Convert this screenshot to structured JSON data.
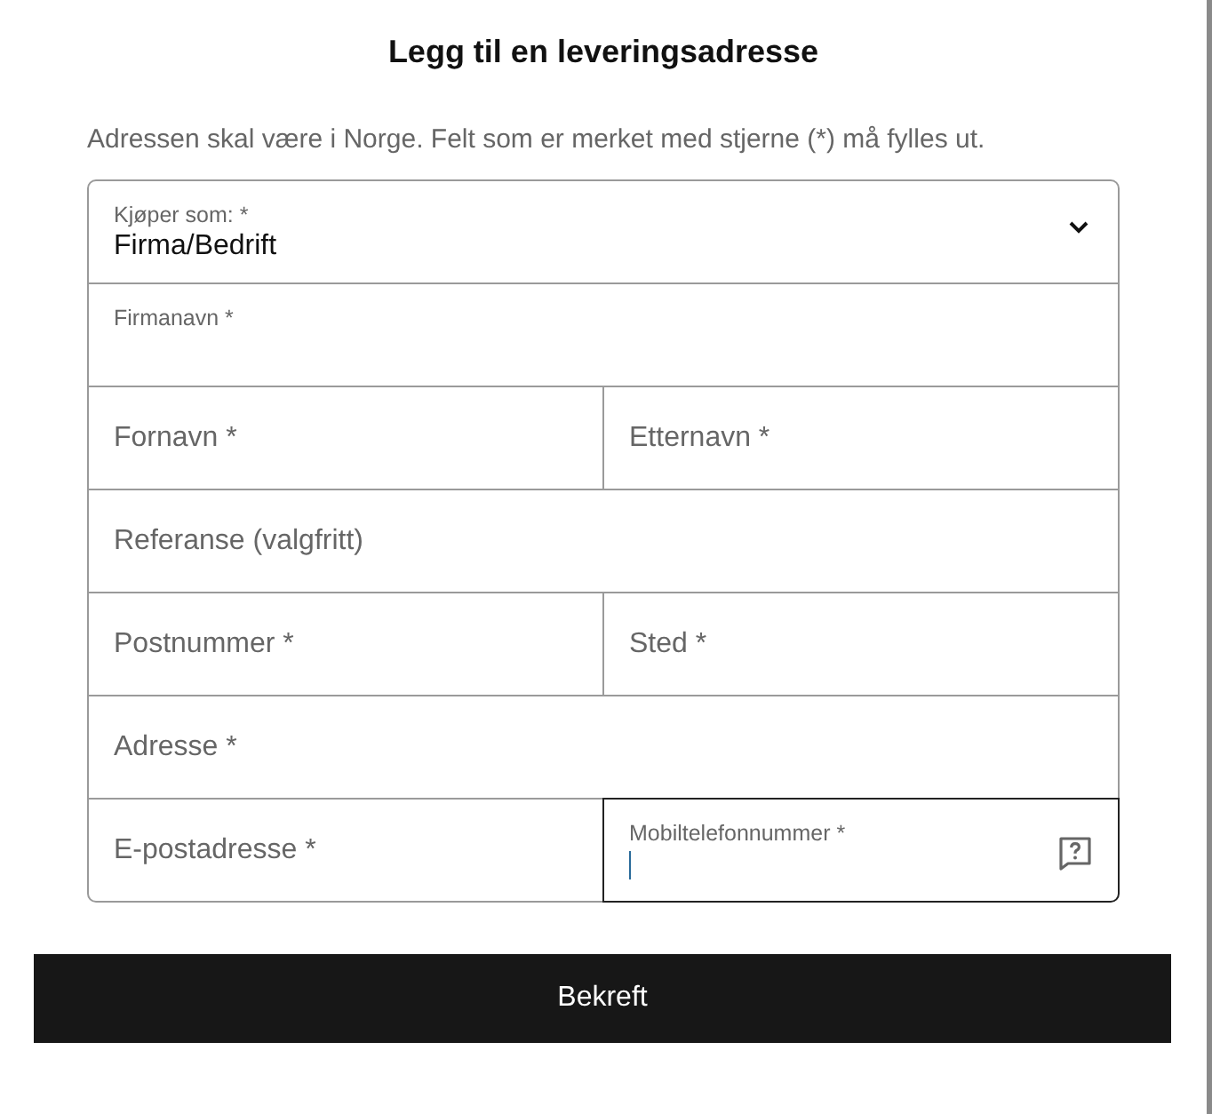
{
  "title": "Legg til en leveringsadresse",
  "intro": "Adressen skal være i Norge. Felt som er merket med stjerne (*) må fylles ut.",
  "rows": [
    [
      {
        "kind": "select",
        "label": "Kjøper som: *",
        "value": "Firma/Bedrift",
        "raised": true,
        "focused": false,
        "help": false
      }
    ],
    [
      {
        "kind": "text",
        "label": "Firmanavn *",
        "raised": true,
        "focused": false,
        "help": false
      }
    ],
    [
      {
        "kind": "text",
        "label": "Fornavn *",
        "raised": false,
        "focused": false,
        "help": false
      },
      {
        "kind": "text",
        "label": "Etternavn *",
        "raised": false,
        "focused": false,
        "help": false
      }
    ],
    [
      {
        "kind": "text",
        "label": "Referanse (valgfritt)",
        "raised": false,
        "focused": false,
        "help": false
      }
    ],
    [
      {
        "kind": "text",
        "label": "Postnummer *",
        "raised": false,
        "focused": false,
        "help": false
      },
      {
        "kind": "text",
        "label": "Sted *",
        "raised": false,
        "focused": false,
        "help": false
      }
    ],
    [
      {
        "kind": "text",
        "label": "Adresse *",
        "raised": false,
        "focused": false,
        "help": false
      }
    ],
    [
      {
        "kind": "text",
        "label": "E-postadresse *",
        "raised": false,
        "focused": false,
        "help": false
      },
      {
        "kind": "text",
        "label": "Mobiltelefonnummer *",
        "raised": true,
        "focused": true,
        "help": true
      }
    ]
  ],
  "button": "Bekreft"
}
